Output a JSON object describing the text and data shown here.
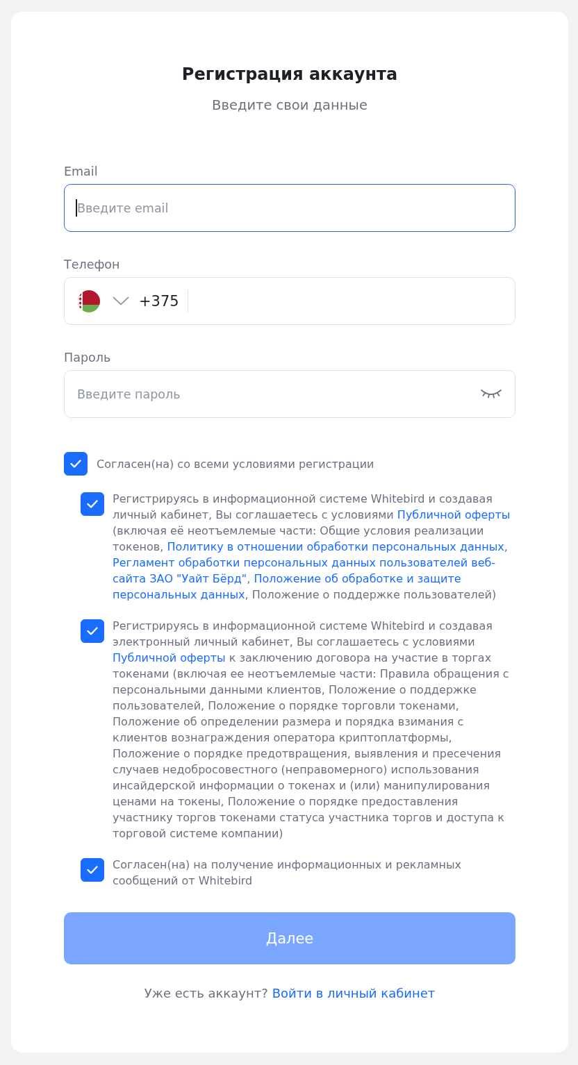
{
  "header": {
    "title": "Регистрация аккаунта",
    "subtitle": "Введите свои данные"
  },
  "fields": [
    {
      "kind": "email",
      "label": "Email",
      "placeholder": "Введите email",
      "focused": true
    },
    {
      "kind": "phone",
      "label": "Телефон",
      "country_code": "+375",
      "focused": false
    },
    {
      "kind": "password",
      "label": "Пароль",
      "placeholder": "Введите пароль",
      "focused": false
    }
  ],
  "agree_all": {
    "label": "Согласен(на) со всеми условиями регистрации",
    "checked": true,
    "children": [
      {
        "checked": true,
        "segments": [
          {
            "kind": "text",
            "text": "Регистрируясь в информационной системе Whitebird и создавая личный кабинет, Вы соглашаетесь с условиями "
          },
          {
            "kind": "link",
            "text": "Публичной оферты"
          },
          {
            "kind": "text",
            "text": " (включая её неотъемлемые части: Общие условия реализации токенов, "
          },
          {
            "kind": "link",
            "text": "Политику в отношении обработки персональных данных"
          },
          {
            "kind": "text",
            "text": ", "
          },
          {
            "kind": "link",
            "text": "Регламент обработки персональных данных пользователей веб-"
          },
          {
            "kind": "link",
            "text": "сайта ЗАО \"Уайт Бёрд\""
          },
          {
            "kind": "text",
            "text": ", "
          },
          {
            "kind": "link",
            "text": "Положение об обработке и защите "
          },
          {
            "kind": "link",
            "text": "персональных данных"
          },
          {
            "kind": "text",
            "text": ", Положение о поддержке пользователей)"
          }
        ]
      },
      {
        "checked": true,
        "segments": [
          {
            "kind": "text",
            "text": "Регистрируясь в информационной системе Whitebird и создавая электронный личный кабинет, Вы соглашаетесь с условиями "
          },
          {
            "kind": "link",
            "text": "Публичной оферты"
          },
          {
            "kind": "text",
            "text": " к заключению договора на участие в торгах токенами (включая ее неотъемлемые части: Правила обращения с персональными данными клиентов, Положение о поддержке пользователей, Положение о порядке торговли токенами, Положение об определении размера и порядка взимания с клиентов вознаграждения оператора криптоплатформы, Положение о порядке предотвращения, выявления и пресечения случаев недобросовестного (неправомерного) использования инсайдерской информации о токенах и (или) манипулирования ценами на токены, Положение о порядке предоставления участнику торгов токенами статуса участника торгов и доступа к торговой системе компании)"
          }
        ]
      },
      {
        "checked": true,
        "segments": [
          {
            "kind": "text",
            "text": "Согласен(на) на получение информационных и рекламных сообщений от Whitebird"
          }
        ]
      }
    ]
  },
  "button": {
    "label": "Далее",
    "disabled": true
  },
  "footer": {
    "prompt": "Уже есть аккаунт?",
    "link": "Войти в личный кабинет"
  }
}
